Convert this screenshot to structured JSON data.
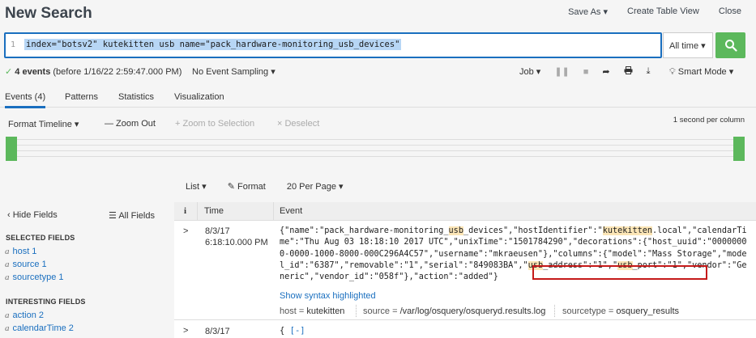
{
  "header": {
    "title": "New Search",
    "save_as": "Save As",
    "create_table_view": "Create Table View",
    "close": "Close"
  },
  "search": {
    "line_number": "1",
    "query": "index=\"botsv2\" kutekitten usb name=\"pack_hardware-monitoring_usb_devices\"",
    "time_range": "All time"
  },
  "status": {
    "check": "✓",
    "event_count": "4 events",
    "before": "(before 1/16/22 2:59:47.000 PM)",
    "sampling": "No Event Sampling",
    "job": "Job",
    "smart_mode": "Smart Mode"
  },
  "tabs": [
    {
      "label": "Events (4)"
    },
    {
      "label": "Patterns"
    },
    {
      "label": "Statistics"
    },
    {
      "label": "Visualization"
    }
  ],
  "timeline": {
    "format": "Format Timeline",
    "zoom_out": "— Zoom Out",
    "zoom_selection": "+ Zoom to Selection",
    "deselect": "× Deselect",
    "resolution": "1 second per column"
  },
  "results_toolbar": {
    "list": "List",
    "format": "Format",
    "per_page": "20 Per Page"
  },
  "sidebar": {
    "hide_fields": "Hide Fields",
    "all_fields": "All Fields",
    "selected_title": "SELECTED FIELDS",
    "selected": [
      {
        "type": "a",
        "name": "host",
        "count": "1"
      },
      {
        "type": "a",
        "name": "source",
        "count": "1"
      },
      {
        "type": "a",
        "name": "sourcetype",
        "count": "1"
      }
    ],
    "interesting_title": "INTERESTING FIELDS",
    "interesting": [
      {
        "type": "a",
        "name": "action",
        "count": "2"
      },
      {
        "type": "a",
        "name": "calendarTime",
        "count": "2"
      }
    ]
  },
  "table": {
    "col_info": "i",
    "col_time": "Time",
    "col_event": "Event",
    "rows": [
      {
        "chevron": ">",
        "date": "8/3/17",
        "time": "6:18:10.000 PM",
        "show_syntax": "Show syntax highlighted",
        "host_label": "host =",
        "host_value": "kutekitten",
        "source_label": "source =",
        "source_value": "/var/log/osquery/osqueryd.results.log",
        "sourcetype_label": "sourcetype =",
        "sourcetype_value": "osquery_results"
      },
      {
        "chevron": ">",
        "date": "8/3/17",
        "event_open": "{",
        "event_toggle": "[-]"
      }
    ]
  },
  "colors": {
    "accent": "#1a6fbf",
    "green": "#5cb85c",
    "highlight": "#fbe5b6",
    "redbox": "#c51a1a"
  }
}
